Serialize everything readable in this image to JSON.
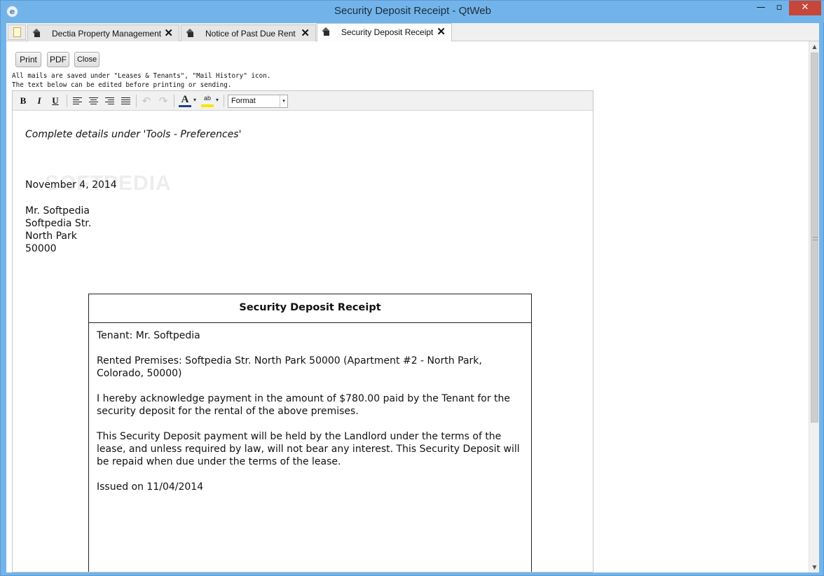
{
  "window": {
    "title": "Security Deposit Receipt - QtWeb",
    "minimize_glyph": "—",
    "maximize_glyph": "▫",
    "close_glyph": "✕",
    "app_icon": "qtweb-globe-icon"
  },
  "tabs": [
    {
      "label": "Dectia Property Management",
      "close_glyph": "✕",
      "icon": "page-icon",
      "active": false
    },
    {
      "label": "Notice of Past Due Rent",
      "close_glyph": "✕",
      "icon": "page-icon",
      "active": false
    },
    {
      "label": "Security Deposit Receipt",
      "close_glyph": "✕",
      "icon": "page-icon",
      "active": true
    }
  ],
  "actions": {
    "print": "Print",
    "pdf": "PDF",
    "close": "Close"
  },
  "info": {
    "line1": "All mails are saved under \"Leases & Tenants\", \"Mail History\" icon.",
    "line2": "The text below can be edited before printing or sending."
  },
  "editor_toolbar": {
    "bold": "B",
    "italic": "I",
    "underline": "U",
    "undo_glyph": "↶",
    "redo_glyph": "↷",
    "font_color_glyph": "A",
    "highlight_glyph": "ab",
    "dropdown_glyph": "▾",
    "format_label": "Format",
    "format_arrow": "▾",
    "highlight_color": "#f5e600",
    "font_color": "#1f3f8f"
  },
  "document": {
    "preferences_note": "Complete details under 'Tools - Preferences'",
    "watermark": "SOFTPEDIA",
    "date": "November 4, 2014",
    "address": [
      "Mr. Softpedia",
      "Softpedia Str.",
      "North Park",
      "50000"
    ],
    "receipt": {
      "title": "Security Deposit Receipt",
      "tenant": "Tenant: Mr. Softpedia",
      "premises": "Rented Premises: Softpedia Str. North Park 50000 (Apartment #2 - North Park, Colorado, 50000)",
      "acknowledgement": "I hereby acknowledge payment in the amount of $780.00 paid by the Tenant for the security deposit for the rental of the above premises.",
      "terms": "This Security Deposit payment will be held by the Landlord under the terms of the lease, and unless required by law, will not bear any interest. This Security Deposit will be repaid when due under the terms of the lease.",
      "issued": "Issued on 11/04/2014"
    }
  },
  "scrollbar": {
    "up_glyph": "▲",
    "down_glyph": "▼"
  }
}
